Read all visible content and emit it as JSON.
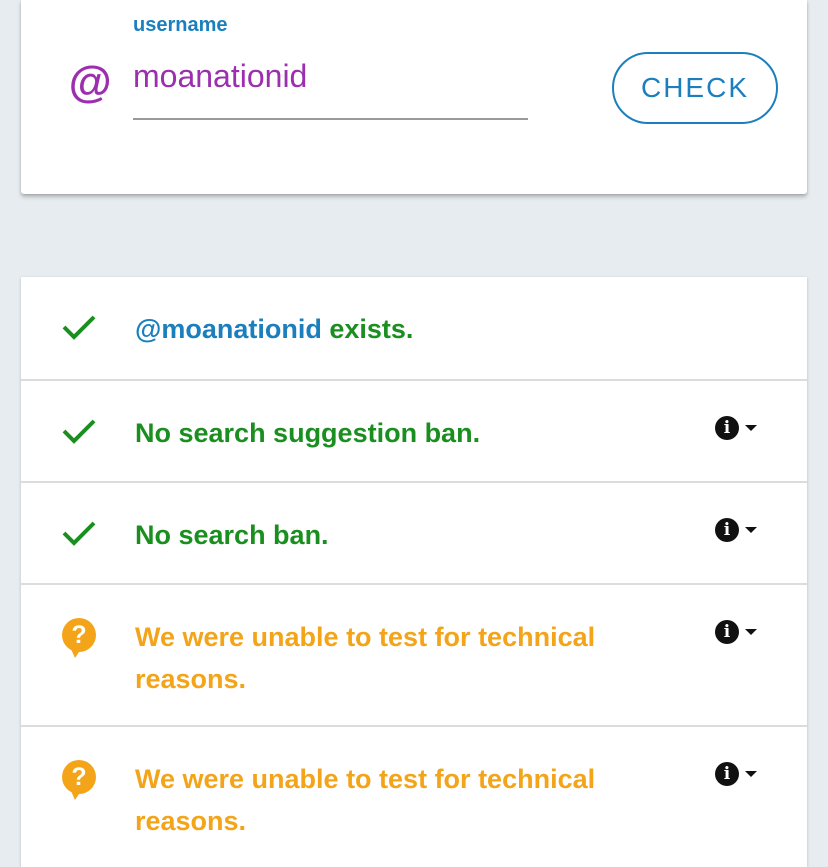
{
  "search": {
    "label": "username",
    "at_symbol": "@",
    "value": "moanationid",
    "button_label": "CHECK"
  },
  "results": [
    {
      "status": "ok",
      "icon": "checkmark-icon",
      "handle": "@moanationid",
      "text": " exists.",
      "has_info": false
    },
    {
      "status": "ok",
      "icon": "checkmark-icon",
      "text": "No search suggestion ban.",
      "has_info": true
    },
    {
      "status": "ok",
      "icon": "checkmark-icon",
      "text": "No search ban.",
      "has_info": true
    },
    {
      "status": "unknown",
      "icon": "question-icon",
      "text": "We were unable to test for technical reasons.",
      "has_info": true
    },
    {
      "status": "unknown",
      "icon": "question-icon",
      "text": "We were unable to test for technical reasons.",
      "has_info": true
    }
  ],
  "icons": {
    "info_glyph": "i",
    "question_glyph": "?"
  },
  "colors": {
    "accent_blue": "#1c7fbd",
    "handle_purple": "#9b2fae",
    "success_green": "#1a8f1f",
    "warning_orange": "#f3a419"
  }
}
